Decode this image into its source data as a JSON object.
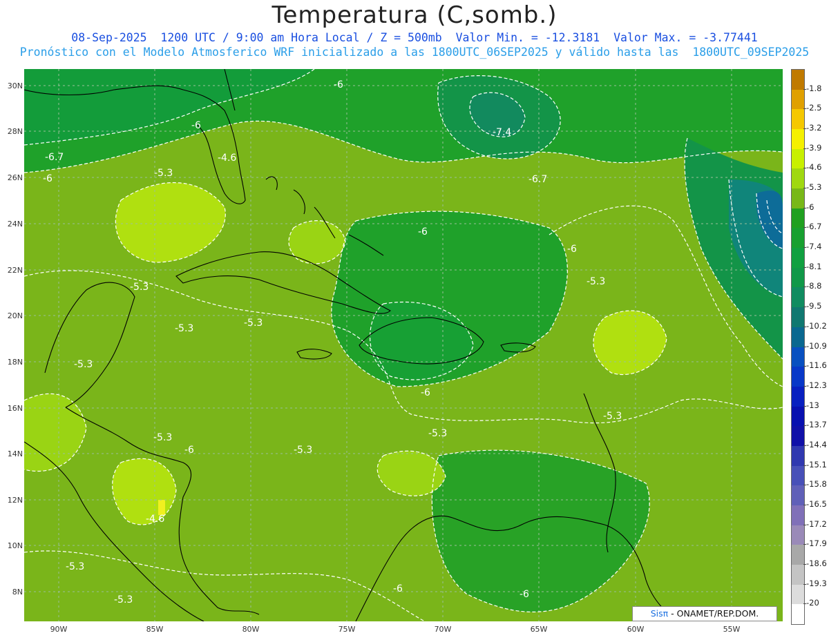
{
  "title": "Temperatura (C,somb.)",
  "subtitle_line1": "08-Sep-2025  1200 UTC / 9:00 am Hora Local / Z = 500mb  Valor Min. = -12.3181  Valor Max. = -3.77441",
  "subtitle_line2": "Pronóstico con el Modelo Atmosferico WRF inicializado a las 1800UTC_06SEP2025 y válido hasta las  1800UTC_09SEP2025",
  "lat_labels": [
    "30N",
    "28N",
    "26N",
    "24N",
    "22N",
    "20N",
    "18N",
    "16N",
    "14N",
    "12N",
    "10N",
    "8N"
  ],
  "lon_labels": [
    "90W",
    "85W",
    "80W",
    "75W",
    "70W",
    "65W",
    "60W",
    "55W"
  ],
  "colorbar": {
    "labels": [
      "-1.8",
      "-2.5",
      "-3.2",
      "-3.9",
      "-4.6",
      "-5.3",
      "-6",
      "-6.7",
      "-7.4",
      "-8.1",
      "-8.8",
      "-9.5",
      "-10.2",
      "-10.9",
      "-11.6",
      "-12.3",
      "-13",
      "-13.7",
      "-14.4",
      "-15.1",
      "-15.8",
      "-16.5",
      "-17.2",
      "-17.9",
      "-18.6",
      "-19.3",
      "-20"
    ],
    "colors": [
      "#c07a00",
      "#e0a000",
      "#f5c800",
      "#f5f000",
      "#c8f000",
      "#a0d810",
      "#78b818",
      "#20a020",
      "#18a030",
      "#10a040",
      "#109848",
      "#108c60",
      "#107870",
      "#0a6890",
      "#0850c0",
      "#0838c8",
      "#0820c0",
      "#0810b0",
      "#1010a8",
      "#3038b0",
      "#4850b8",
      "#6060b8",
      "#8070b8",
      "#9a8ab8",
      "#a8a8a8",
      "#c4c4c4",
      "#dcdcdc",
      "#ffffff"
    ]
  },
  "contour_labels": [
    {
      "text": "-6"
    },
    {
      "text": "-6"
    },
    {
      "text": "-6.7"
    },
    {
      "text": "-6"
    },
    {
      "text": "-5.3"
    },
    {
      "text": "-4.6"
    },
    {
      "text": "-7.4"
    },
    {
      "text": "-6.7"
    },
    {
      "text": "-6"
    },
    {
      "text": "-6"
    },
    {
      "text": "-5.3"
    },
    {
      "text": "-5.3"
    },
    {
      "text": "-5.3"
    },
    {
      "text": "-5.3"
    },
    {
      "text": "-5.3"
    },
    {
      "text": "-6"
    },
    {
      "text": "-5.3"
    },
    {
      "text": "-5.3"
    },
    {
      "text": "-5.3"
    },
    {
      "text": "-6"
    },
    {
      "text": "-4.6"
    },
    {
      "text": "-5.3"
    },
    {
      "text": "-5.3"
    },
    {
      "text": "-6"
    },
    {
      "text": "-6"
    },
    {
      "text": "-5.3"
    }
  ],
  "credit": {
    "brand": "Sisπ",
    "text": " - ONAMET/REP.DOM."
  }
}
